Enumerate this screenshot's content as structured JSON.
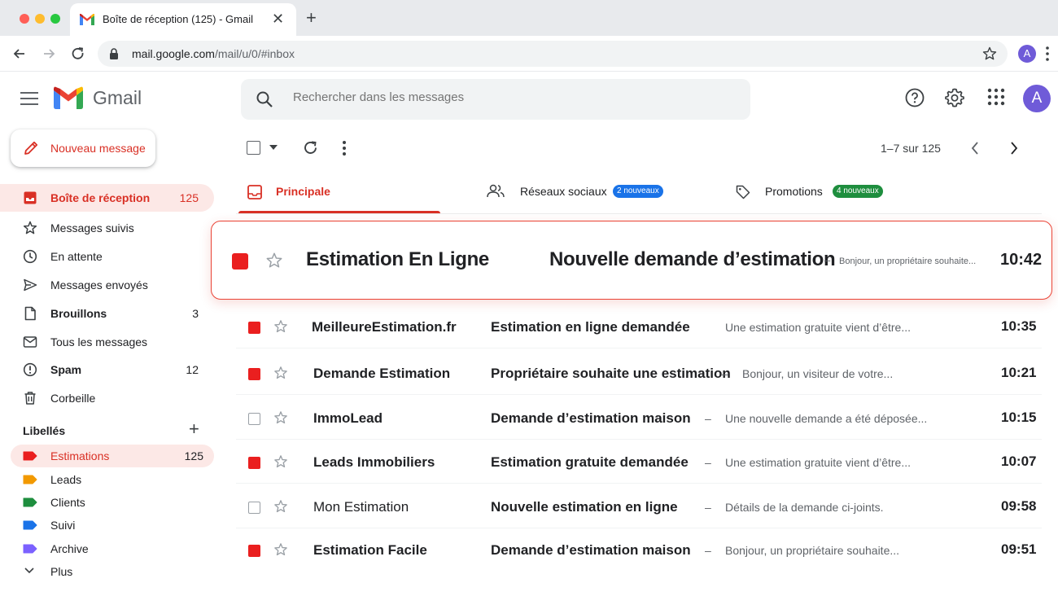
{
  "browser": {
    "tab_title": "Boîte de réception (125) - Gmail",
    "url_host": "mail.google.com",
    "url_path": "/mail/u/0/#inbox",
    "profile_initial": "A"
  },
  "gmail": {
    "product_name": "Gmail",
    "search_placeholder": "Rechercher dans les messages",
    "avatar_initial": "A",
    "compose_label": "Nouveau message"
  },
  "sidebar": {
    "items": [
      {
        "label": "Boîte de réception",
        "count": "125",
        "icon": "inbox-icon"
      },
      {
        "label": "Messages suivis",
        "count": "",
        "icon": "star-icon"
      },
      {
        "label": "En attente",
        "count": "",
        "icon": "clock-icon"
      },
      {
        "label": "Messages envoyés",
        "count": "",
        "icon": "send-icon"
      },
      {
        "label": "Brouillons",
        "count": "3",
        "icon": "draft-icon"
      },
      {
        "label": "Tous les messages",
        "count": "",
        "icon": "all-mail-icon"
      },
      {
        "label": "Spam",
        "count": "12",
        "icon": "spam-icon"
      },
      {
        "label": "Corbeille",
        "count": "",
        "icon": "trash-icon"
      }
    ],
    "labels_title": "Libellés",
    "labels": [
      {
        "name": "Estimations",
        "count": "125",
        "color": "#ea1f1f"
      },
      {
        "name": "Leads",
        "count": "",
        "color": "#f29900"
      },
      {
        "name": "Clients",
        "count": "",
        "color": "#1e8e3e"
      },
      {
        "name": "Suivi",
        "count": "",
        "color": "#1a73e8"
      },
      {
        "name": "Archive",
        "count": "",
        "color": "#7b61ff"
      }
    ],
    "more_label": "Plus"
  },
  "toolbar": {
    "pager": "1–7 sur 125"
  },
  "categories": [
    {
      "label": "Principale",
      "badge": "",
      "color": "#d93025"
    },
    {
      "label": "Réseaux sociaux",
      "badge": "2 nouveaux",
      "color": "#1a73e8"
    },
    {
      "label": "Promotions",
      "badge": "4 nouveaux",
      "color": "#1e8e3e"
    }
  ],
  "featured_message": {
    "sender": "Estimation En Ligne",
    "subject": "Nouvelle demande d’estimation",
    "dash": "–",
    "snippet": "Bonjour, un propriétaire souhaite...",
    "time": "10:42"
  },
  "messages": [
    {
      "sender": "MeilleureEstimation.fr",
      "subject": "Estimation en ligne demandée",
      "dash": "",
      "snippet": "Une estimation gratuite vient d’être...",
      "time": "10:35",
      "checked": true,
      "bold": true
    },
    {
      "sender": "Demande Estimation",
      "subject": "Propriétaire souhaite une estimation",
      "dash": "–",
      "snippet": "Bonjour, un visiteur de votre...",
      "time": "10:21",
      "checked": true,
      "bold": true
    },
    {
      "sender": "ImmoLead",
      "subject": "Demande d’estimation maison",
      "dash": "–",
      "snippet": "Une nouvelle demande a été déposée...",
      "time": "10:15",
      "checked": false,
      "bold": true
    },
    {
      "sender": "Leads Immobiliers",
      "subject": "Estimation gratuite demandée",
      "dash": "–",
      "snippet": "Une estimation gratuite vient d’être...",
      "time": "10:07",
      "checked": true,
      "bold": true
    },
    {
      "sender": "Mon Estimation",
      "subject": "Nouvelle estimation en ligne",
      "dash": "–",
      "snippet": "Détails de la demande ci-joints.",
      "time": "09:58",
      "checked": false,
      "bold": false
    },
    {
      "sender": "Estimation Facile",
      "subject": "Demande d’estimation maison",
      "dash": "–",
      "snippet": "Bonjour, un propriétaire souhaite...",
      "time": "09:51",
      "checked": true,
      "bold": true
    }
  ],
  "colors": {
    "accent": "#d93025",
    "brand_red": "#ea4335",
    "active_bg": "#fce8e6"
  }
}
